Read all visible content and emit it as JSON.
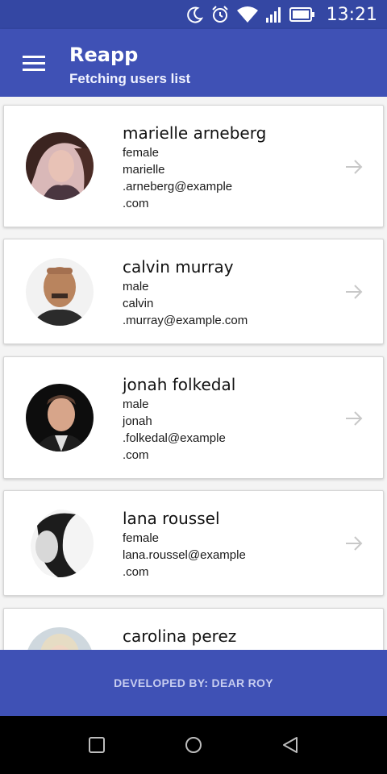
{
  "status_bar": {
    "time": "13:21",
    "icons": [
      "moon-icon",
      "alarm-icon",
      "wifi-icon",
      "signal-icon",
      "battery-icon"
    ]
  },
  "app_bar": {
    "title": "Reapp",
    "subtitle": "Fetching users list",
    "menu_icon": "menu-icon"
  },
  "users": [
    {
      "name": "marielle arneberg",
      "gender": "female",
      "email_lines": [
        "marielle",
        ".arneberg@example",
        ".com"
      ]
    },
    {
      "name": "calvin murray",
      "gender": "male",
      "email_lines": [
        "calvin",
        ".murray@example.com"
      ]
    },
    {
      "name": "jonah folkedal",
      "gender": "male",
      "email_lines": [
        "jonah",
        ".folkedal@example",
        ".com"
      ]
    },
    {
      "name": "lana roussel",
      "gender": "female",
      "email_lines": [
        "lana.roussel@example",
        ".com"
      ]
    },
    {
      "name": "carolina perez",
      "gender": "",
      "email_lines": []
    }
  ],
  "footer": {
    "text": "DEVELOPED BY: DEAR ROY"
  },
  "colors": {
    "primary": "#3f51b5",
    "primary_dark": "#3447a3",
    "footer_text": "#c7cdf0",
    "arrow": "#c8c8c8"
  }
}
